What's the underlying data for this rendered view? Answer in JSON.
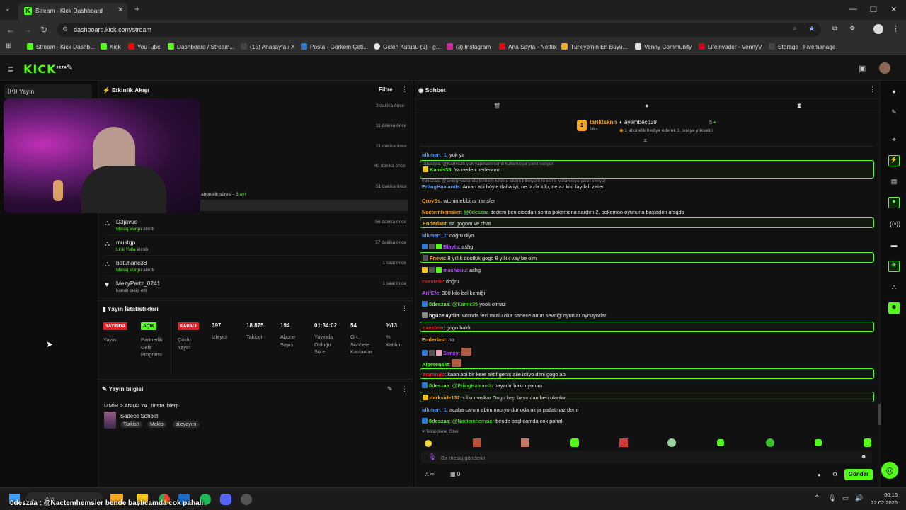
{
  "browser": {
    "tab_title": "Stream - Kick Dashboard",
    "url": "dashboard.kick.com/stream",
    "bookmarks": [
      {
        "label": "Stream - Kick Dashb...",
        "color": "#53fc18"
      },
      {
        "label": "Kick",
        "color": "#53fc18"
      },
      {
        "label": "YouTube",
        "color": "#ff0000"
      },
      {
        "label": "Dashboard / Stream...",
        "color": "#53fc18"
      },
      {
        "label": "(15) Anasayfa / X",
        "color": "#111111"
      },
      {
        "label": "Posta - Görkem Çeti...",
        "color": "#2f7bd4"
      },
      {
        "label": "Gelen Kutusu (9) - g...",
        "color": "#e7e7e7"
      },
      {
        "label": "(3) Instagram",
        "color": "#d6249f"
      },
      {
        "label": "Ana Sayfa - Netflix",
        "color": "#e50914"
      },
      {
        "label": "Türkiye'nin En Büyü...",
        "color": "#f5a623"
      },
      {
        "label": "Venny Community",
        "color": "#e0e0e0"
      },
      {
        "label": "Lifeinvader - VennyV",
        "color": "#d0021b"
      },
      {
        "label": "Storage | Fivemanage",
        "color": "#111111"
      }
    ]
  },
  "kick": {
    "logo": "KICK",
    "logo_tag": "BETA"
  },
  "sidebar": {
    "selected": "Yayın"
  },
  "activity": {
    "title": "Etkinlik Akışı",
    "filter": "Filtre",
    "hidden_times": [
      "3 dakika önce",
      "11 dakika önce",
      "21 dakika önce",
      "43 dakika önce",
      "51 dakika önce"
    ],
    "partial_text": "abonelik süresi - ",
    "partial_value": "3 ay!",
    "events": [
      {
        "name": "D3javuo",
        "sub_green": "Mesaj Vurgu",
        "sub": "alındı",
        "time": "56 dakika önce",
        "icon": "⛬"
      },
      {
        "name": "mustgp",
        "sub_green": "Link Yolla",
        "sub": "alındı",
        "time": "57 dakika önce",
        "icon": "⛬"
      },
      {
        "name": "batuhanc38",
        "sub_green": "Mesaj Vurgu",
        "sub": "alındı",
        "time": "1 saat önce",
        "icon": "⛬"
      },
      {
        "name": "MezyPartz_0241",
        "sub_green": "",
        "sub": "kanalı takip etti",
        "time": "1 saat önce",
        "icon": "♥"
      }
    ]
  },
  "stats": {
    "title": "Yayın İstatistikleri",
    "badges": [
      {
        "badge": "YAYINDA",
        "color": "#e21f26",
        "label": "Yayın"
      },
      {
        "badge": "AÇIK",
        "color": "#53fc18",
        "label": "Partnerlik Gelir Programı"
      },
      {
        "badge": "KAPALI",
        "color": "#e21f26",
        "label": "Çoklu Yayın"
      }
    ],
    "metrics": [
      {
        "value": "397",
        "label": "İzleyici"
      },
      {
        "value": "18.875",
        "label": "Takipçi"
      },
      {
        "value": "194",
        "label": "Abone Sayısı"
      },
      {
        "value": "01:34:02",
        "label": "Yayında Olduğu Süre"
      },
      {
        "value": "54",
        "label": "Ort. Sohbete Katılanlar"
      },
      {
        "value": "%13",
        "label": "% Katılım"
      }
    ]
  },
  "info": {
    "title": "Yayın bilgisi",
    "stream_title": "İZMİR > ANTALYA | !insta !blerp",
    "category": "Sadece Sohbet",
    "tags": [
      "Turkish",
      "Mekip",
      "aileyayını"
    ]
  },
  "chat": {
    "title": "Sohbet",
    "top_gifter": "tariktsknn",
    "top_gifter_count": "16",
    "top_rank": "1",
    "gift_user": "ayembeco39",
    "gift_count": "5",
    "gift_text": "1 abonelik hediye ederek 3. sıraya yükseldi",
    "messages": [
      {
        "user": "idkmert_1",
        "color": "#5aa0ff",
        "text": "yok ya",
        "hl": false,
        "reply": "",
        "icons": []
      },
      {
        "user": "Kamis35",
        "color": "#53fc18",
        "text": "Ya neden nedennnn",
        "hl": true,
        "reply": "0deszaa: @Kamis35 yok yapmam isimli kullanıcıya yanıt veriyor",
        "icons": [
          "#f5c518"
        ]
      },
      {
        "user": "ErlingHaalands",
        "color": "#5aa0ff",
        "text": "Aman abi böyle daha iyi, ne fazla kilo, ne az kilo faydalı zaten",
        "hl": false,
        "reply": "0deszaa: @ErlingHaalands bilmem kilomu aldım bilmiyom ki isimli kullanıcıya yanıt veriyor",
        "icons": []
      },
      {
        "user": "QroySs",
        "color": "#f5a623",
        "text": "wtcnin ekibins transfer",
        "hl": false,
        "reply": "",
        "icons": []
      },
      {
        "user": "Nactemhemsier",
        "color": "#f5a623",
        "text": "@0deszaa dedem ben cibodan sonra pokemona sardım 2. pokemon oyununa başladım afsgds",
        "hl": false,
        "reply": "",
        "icons": [],
        "mention": "@0deszaa"
      },
      {
        "user": "Enderlast",
        "color": "#f5a623",
        "text": "sa gogom ve chat",
        "hl": true,
        "reply": "",
        "icons": []
      },
      {
        "user": "idkmert_1",
        "color": "#5aa0ff",
        "text": "doğru diyo",
        "hl": false,
        "reply": "",
        "icons": []
      },
      {
        "user": "Blayts",
        "color": "#b44dff",
        "text": "ashg",
        "hl": false,
        "reply": "",
        "icons": [
          "#2f7bd4",
          "#555",
          "#53fc18"
        ]
      },
      {
        "user": "Fnevs",
        "color": "#f5a623",
        "text": "8 yıllık dostluk gogo 8 yıllık vay be olm",
        "hl": true,
        "reply": "",
        "icons": [
          "#555"
        ]
      },
      {
        "user": "mashouu",
        "color": "#b44dff",
        "text": "ashg",
        "hl": false,
        "reply": "",
        "icons": [
          "#f5c518",
          "#555",
          "#53fc18"
        ]
      },
      {
        "user": "cxestein",
        "color": "#e21f26",
        "text": "doğru",
        "hl": false,
        "reply": "",
        "icons": []
      },
      {
        "user": "ArifEfe",
        "color": "#b44dff",
        "text": "300 kilo bel kemiği",
        "hl": false,
        "reply": "",
        "icons": []
      },
      {
        "user": "0deszaa",
        "color": "#53fc18",
        "text": "@Kamis35 yook olmaz",
        "hl": false,
        "reply": "",
        "icons": [
          "#2f7bd4"
        ],
        "mention": "@Kamis35"
      },
      {
        "user": "bguzelaydin",
        "color": "#e8e8e8",
        "text": "wtcnda feci mutlu olur sadece onun sevdiği oyunlar oynuyorlar",
        "hl": false,
        "reply": "",
        "icons": [
          "#888"
        ]
      },
      {
        "user": "cxestein",
        "color": "#e21f26",
        "text": "gogo haklı",
        "hl": true,
        "reply": "",
        "icons": []
      },
      {
        "user": "Enderlast",
        "color": "#f5a623",
        "text": "hb",
        "hl": false,
        "reply": "",
        "icons": []
      },
      {
        "user": "Simxy",
        "color": "#b44dff",
        "text": "",
        "hl": false,
        "reply": "",
        "icons": [
          "#2f7bd4",
          "#555",
          "#e6a1b8"
        ],
        "emote": true
      },
      {
        "user": "Alperenskt",
        "color": "#53fc18",
        "text": "",
        "hl": false,
        "reply": "",
        "icons": [],
        "emote": true
      },
      {
        "user": "emmrulo",
        "color": "#e21f26",
        "text": "kaan abi bir kere aktif geniş aile izliyo dimi gogo abi",
        "hl": true,
        "reply": "",
        "icons": []
      },
      {
        "user": "0deszaa",
        "color": "#53fc18",
        "text": "@ErlingHaalands bayadır bakmıyorum",
        "hl": false,
        "reply": "",
        "icons": [
          "#2f7bd4"
        ],
        "mention": "@ErlingHaalands"
      },
      {
        "user": "darkside132",
        "color": "#f5a623",
        "text": "cibo maskar Gogo hep başından beri olanlar",
        "hl": true,
        "reply": "",
        "icons": [
          "#f5c518"
        ]
      },
      {
        "user": "idkmert_1",
        "color": "#5aa0ff",
        "text": "acaba canım abim napıyordur oda ninja patlatmaz demi",
        "hl": false,
        "reply": "",
        "icons": []
      },
      {
        "user": "0deszaa",
        "color": "#53fc18",
        "text": "@Nactemhemsier bende başlıcamda cok pahalı",
        "hl": false,
        "reply": "",
        "icons": [
          "#2f7bd4"
        ],
        "mention": "@Nactemhemsier"
      }
    ],
    "followers_only": "Takipçilere Özel",
    "placeholder": "Bir mesaj gönderin",
    "send": "Gönder",
    "points": "0"
  },
  "taskbar": {
    "search": "Ara",
    "time": "00:16",
    "date": "22.02.2026"
  },
  "overlay_text": "0deszaa : @Nactemhemsier bende başlıcamda cok pahalı"
}
